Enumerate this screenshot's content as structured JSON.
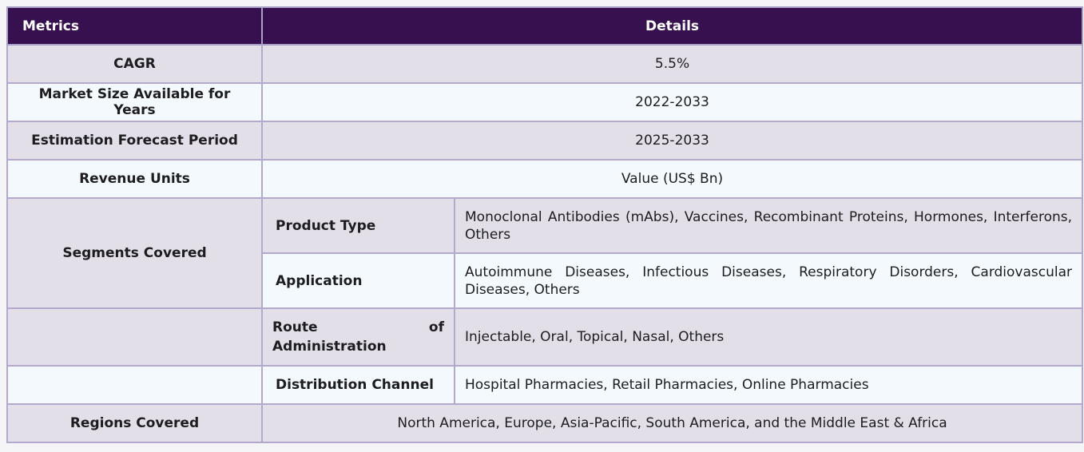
{
  "table": {
    "header": {
      "metrics": "Metrics",
      "details": "Details"
    },
    "cagr": {
      "label": "CAGR",
      "value": "5.5%"
    },
    "market_size": {
      "label": "Market Size Available for Years",
      "value": "2022-2033"
    },
    "forecast": {
      "label": "Estimation Forecast Period",
      "value": "2025-2033"
    },
    "revenue": {
      "label": "Revenue Units",
      "value": "Value (US$ Bn)"
    },
    "segments": {
      "label": "Segments Covered",
      "rows": [
        {
          "name": "Product Type",
          "value": "Monoclonal Antibodies (mAbs), Vaccines, Recombinant Proteins, Hormones, Interferons, Others"
        },
        {
          "name": "Application",
          "value": "Autoimmune Diseases, Infectious Diseases, Respiratory Disorders, Cardiovascular Diseases, Others"
        },
        {
          "name": "Route of Administration",
          "value": "Injectable, Oral, Topical, Nasal, Others"
        },
        {
          "name": "Distribution Channel",
          "value": "Hospital Pharmacies, Retail Pharmacies, Online Pharmacies"
        }
      ]
    },
    "regions": {
      "label": "Regions Covered",
      "value": "North America, Europe, Asia-Pacific, South America, and the Middle East & Africa"
    }
  },
  "colors": {
    "header_bg": "#37114f",
    "row_odd": "#e2dfe9",
    "row_even": "#f3f9fc",
    "border": "#b2a9cc"
  }
}
